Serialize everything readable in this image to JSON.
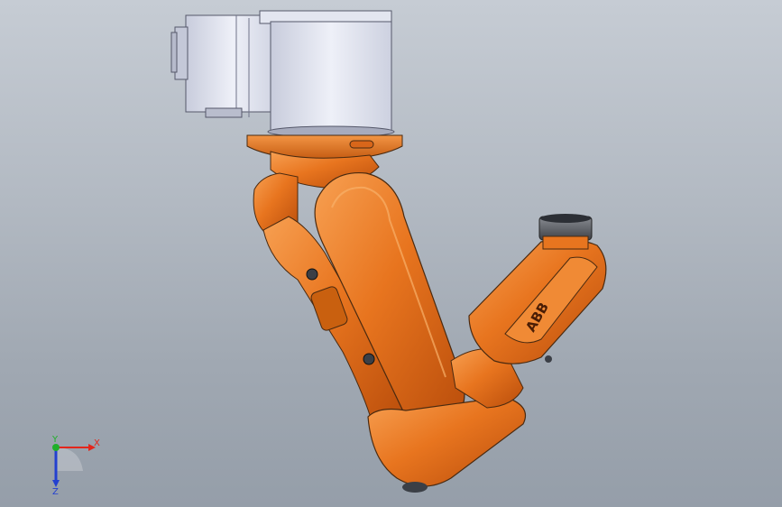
{
  "model": {
    "brand_marking": "ABB"
  },
  "triad": {
    "x_label": "X",
    "y_label": "Y",
    "z_label": "Z",
    "x_color": "#e3261b",
    "y_color": "#1fb02a",
    "z_color": "#2340d0"
  },
  "colors": {
    "background_top": "#c6ccd4",
    "background_bottom": "#959ea9",
    "robot_orange": "#e8751f",
    "motor_housing": "#d7dbe8"
  }
}
